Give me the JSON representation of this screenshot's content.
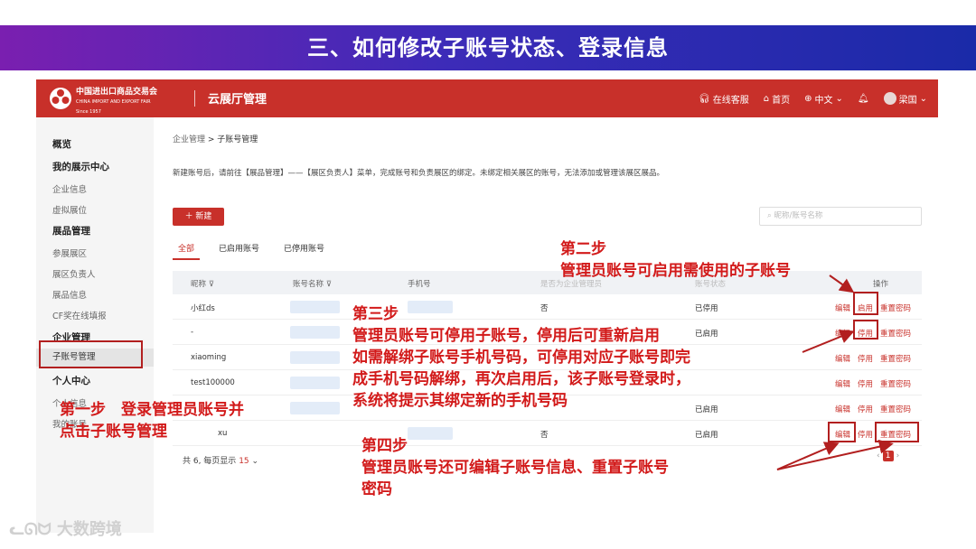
{
  "slide": {
    "title": "三、如何修改子账号状态、登录信息",
    "watermark": "大数跨境"
  },
  "header": {
    "logo_cn": "中国进出口商品交易会",
    "logo_en": "CHINA IMPORT AND EXPORT FAIR",
    "logo_since": "Since 1957",
    "app_title": "云展厅管理",
    "service": "在线客服",
    "home": "首页",
    "language": "中文",
    "user": "梁国",
    "brand_color": "#c8302a"
  },
  "sidebar": {
    "items": [
      {
        "label": "概览",
        "group": true
      },
      {
        "label": "我的展示中心",
        "group": true
      },
      {
        "label": "企业信息"
      },
      {
        "label": "虚拟展位"
      },
      {
        "label": "展品管理",
        "group": true
      },
      {
        "label": "参展展区"
      },
      {
        "label": "展区负责人"
      },
      {
        "label": "展品信息"
      },
      {
        "label": "CF奖在线填报"
      },
      {
        "label": "企业管理",
        "group": true
      },
      {
        "label": "子账号管理",
        "active": true
      },
      {
        "label": "个人中心",
        "group": true
      },
      {
        "label": "个人信息"
      },
      {
        "label": "我的账号"
      }
    ]
  },
  "main": {
    "breadcrumb_parent": "企业管理",
    "breadcrumb_sep": " > ",
    "breadcrumb_current": "子账号管理",
    "notice": "新建账号后，请前往【展品管理】——【展区负责人】菜单，完成账号和负责展区的绑定。未绑定相关展区的账号，无法添加或管理该展区展品。",
    "new_button": "＋ 新建",
    "search_placeholder": "昵称/账号名称",
    "tabs": [
      "全部",
      "已启用账号",
      "已停用账号"
    ],
    "columns": [
      "昵称",
      "账号名称",
      "手机号",
      "是否为企业管理员",
      "账号状态",
      "操作"
    ],
    "rows": [
      {
        "nickname": "小红ds",
        "admin": "否",
        "status": "已停用",
        "actions": [
          "编辑",
          "启用",
          "重置密码"
        ]
      },
      {
        "nickname": "-",
        "admin": "",
        "status": "已启用",
        "actions": [
          "编辑",
          "停用",
          "重置密码"
        ]
      },
      {
        "nickname": "xiaoming",
        "admin": "",
        "status": "",
        "actions": [
          "编辑",
          "停用",
          "重置密码"
        ]
      },
      {
        "nickname": "test100000",
        "admin": "",
        "status": "",
        "actions": [
          "编辑",
          "停用",
          "重置密码"
        ]
      },
      {
        "nickname": "",
        "admin": "",
        "status": "已启用",
        "actions": [
          "编辑",
          "停用",
          "重置密码"
        ]
      },
      {
        "nickname": "xu",
        "admin": "否",
        "status": "已启用",
        "actions": [
          "编辑",
          "停用",
          "重置密码"
        ]
      }
    ],
    "footer_prefix": "共 6, 每页显示",
    "page_size": "15",
    "current_page": "1"
  },
  "annotations": {
    "step1_line1": "第一步　登录管理员账号并",
    "step1_line2": "点击子账号管理",
    "step2_line1": "第二步",
    "step2_line2": "管理员账号可启用需使用的子账号",
    "step3_line1": "第三步",
    "step3_line2": "管理员账号可停用子账号，停用后可重新启用",
    "step3_line3": "如需解绑子账号手机号码，可停用对应子账号即完",
    "step3_line4": "成手机号码解绑，再次启用后，该子账号登录时，",
    "step3_line5": "系统将提示其绑定新的手机号码",
    "step4_line1": "第四步",
    "step4_line2": "管理员账号还可编辑子账号信息、重置子账号",
    "step4_line3": "密码",
    "color": "#d21a1a"
  }
}
